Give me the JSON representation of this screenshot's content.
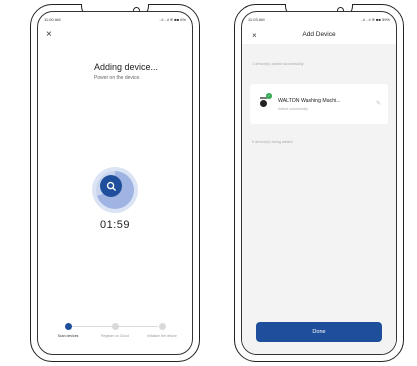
{
  "left_screen": {
    "status_time": "11:00 AM",
    "status_icons": "..ıl ..ıl ≋ ■■ 6%",
    "close_label": "×",
    "title": "Adding device...",
    "hint": "Power on the device.",
    "timer": "01:59",
    "progress_ring_fraction": 0.7,
    "steps": [
      {
        "label": "Scan devices",
        "active": true
      },
      {
        "label": "Register on Cloud",
        "active": false
      },
      {
        "label": "Initialize the device",
        "active": false
      }
    ]
  },
  "right_screen": {
    "status_time": "11:03 AM",
    "status_icons": "..ıl ..ıl ≋ ■■ 59%",
    "close_label": "×",
    "title": "Add Device",
    "section_added": "1 device(s) added successfully",
    "device_name": "WALTON Washing Machi...",
    "device_status": "Added successfully",
    "edit_icon": "pencil-icon",
    "section_failed": "0 device(s) being added",
    "done_label": "Done"
  },
  "colors": {
    "primary": "#1f4f9c",
    "ring": "#9fb4e2",
    "success": "#2fa84f"
  }
}
